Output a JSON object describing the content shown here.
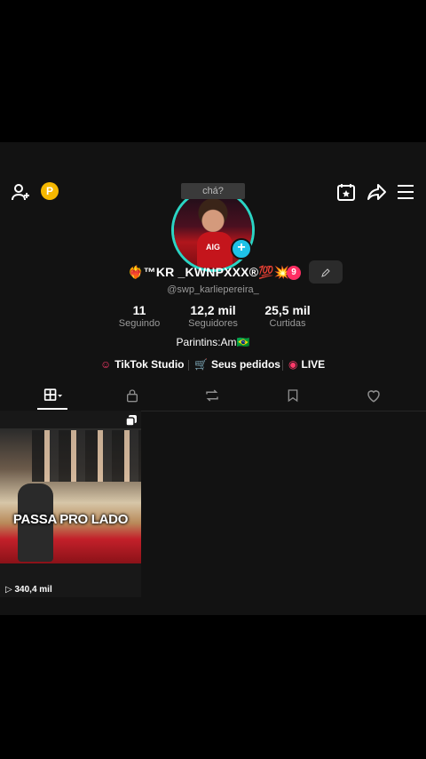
{
  "header": {
    "add_friend_icon": "person-plus-icon",
    "coin_label": "P",
    "calendar_icon": "calendar-star-icon",
    "share_icon": "share-arrow-icon",
    "menu_icon": "hamburger-menu-icon"
  },
  "profile": {
    "bubble_text": "chá?",
    "display_name": "™KR _KWNPXXX®",
    "emoji_suffix": "💯💥",
    "name_prefix_emoji": "❤️‍🔥",
    "badge_count": "9",
    "username": "@swp_karliepereira_",
    "stats": [
      {
        "value": "11",
        "label": "Seguindo"
      },
      {
        "value": "12,2 mil",
        "label": "Seguidores"
      },
      {
        "value": "25,5 mil",
        "label": "Curtidas"
      }
    ],
    "bio": "Parintins:Am🇧🇷",
    "links": [
      {
        "label": "TikTok Studio"
      },
      {
        "label": "Seus pedidos"
      },
      {
        "label": "LIVE"
      }
    ]
  },
  "tabs": [
    {
      "name": "grid",
      "icon": "grid-icon"
    },
    {
      "name": "private",
      "icon": "lock-icon"
    },
    {
      "name": "reposts",
      "icon": "repost-icon"
    },
    {
      "name": "saved",
      "icon": "bookmark-icon"
    },
    {
      "name": "liked",
      "icon": "heart-icon"
    }
  ],
  "videos": [
    {
      "caption": "PASSA PRO LADO",
      "views": "340,4 mil"
    }
  ],
  "colors": {
    "accent": "#ff3b6b",
    "avatar_ring": "#2bd4c4",
    "plus": "#1fc2e8",
    "coin": "#f5b800"
  }
}
